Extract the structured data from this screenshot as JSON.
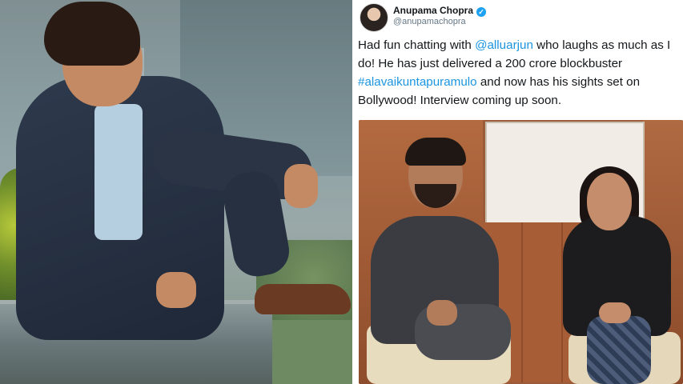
{
  "tweet": {
    "display_name": "Anupama Chopra",
    "handle": "@anupamachopra",
    "verified_glyph": "✓",
    "text_part1": "Had fun chatting with ",
    "mention": "@alluarjun",
    "text_part2": " who laughs as much as I do! He has just delivered a 200 crore blockbuster ",
    "hashtag": "#alavaikuntapuramulo",
    "text_part3": " and now has his sights set on Bollywood! Interview coming up soon."
  },
  "colors": {
    "link": "#1b95e0",
    "verified": "#1da1f2",
    "text": "#14171a",
    "handle": "#657786"
  },
  "icons": {
    "verified": "verified-badge-icon",
    "avatar": "profile-avatar"
  }
}
